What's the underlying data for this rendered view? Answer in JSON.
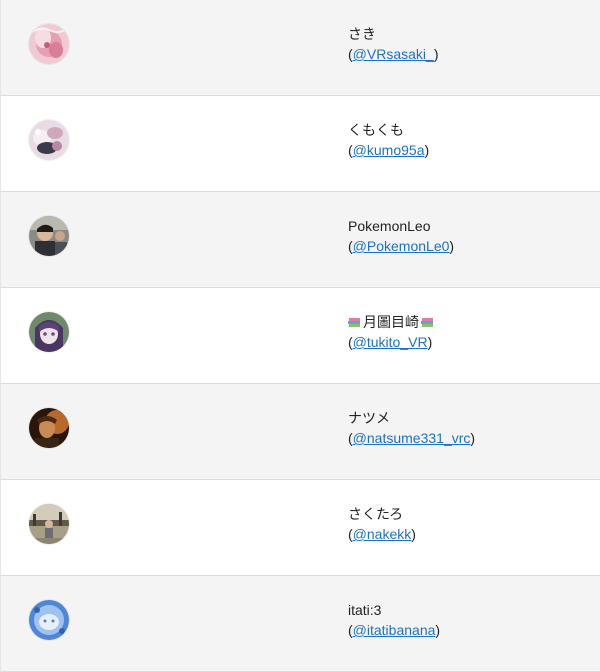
{
  "users": [
    {
      "name": "さき",
      "handle": "@VRsasaki_",
      "avatar_icon": "avatar-pink-anime-icon",
      "avatar_color": "#e8a9b8"
    },
    {
      "name": "くもくも",
      "handle": "@kumo95a",
      "avatar_icon": "avatar-cloud-cat-icon",
      "avatar_color": "#d8c3cf"
    },
    {
      "name": "PokemonLeo",
      "handle": "@PokemonLe0",
      "avatar_icon": "avatar-photo-people-icon",
      "avatar_color": "#5b5a58"
    },
    {
      "name": "月圖目崎",
      "handle": "@tukito_VR",
      "avatar_icon": "avatar-purple-anime-icon",
      "avatar_color": "#7a5f90",
      "emoji": "books-icon"
    },
    {
      "name": "ナツメ",
      "handle": "@natsume331_vrc",
      "avatar_icon": "avatar-brown-character-icon",
      "avatar_color": "#6b3a18"
    },
    {
      "name": "さくたろ",
      "handle": "@nakekk",
      "avatar_icon": "avatar-outdoor-photo-icon",
      "avatar_color": "#8f8770"
    },
    {
      "name": "itati:3",
      "handle": "@itatibanana",
      "avatar_icon": "avatar-blue-creature-icon",
      "avatar_color": "#7aa6e0"
    }
  ],
  "colors": {
    "link": "#1a73c8",
    "row_alt": "#f4f4f4",
    "row_plain": "#ffffff"
  }
}
